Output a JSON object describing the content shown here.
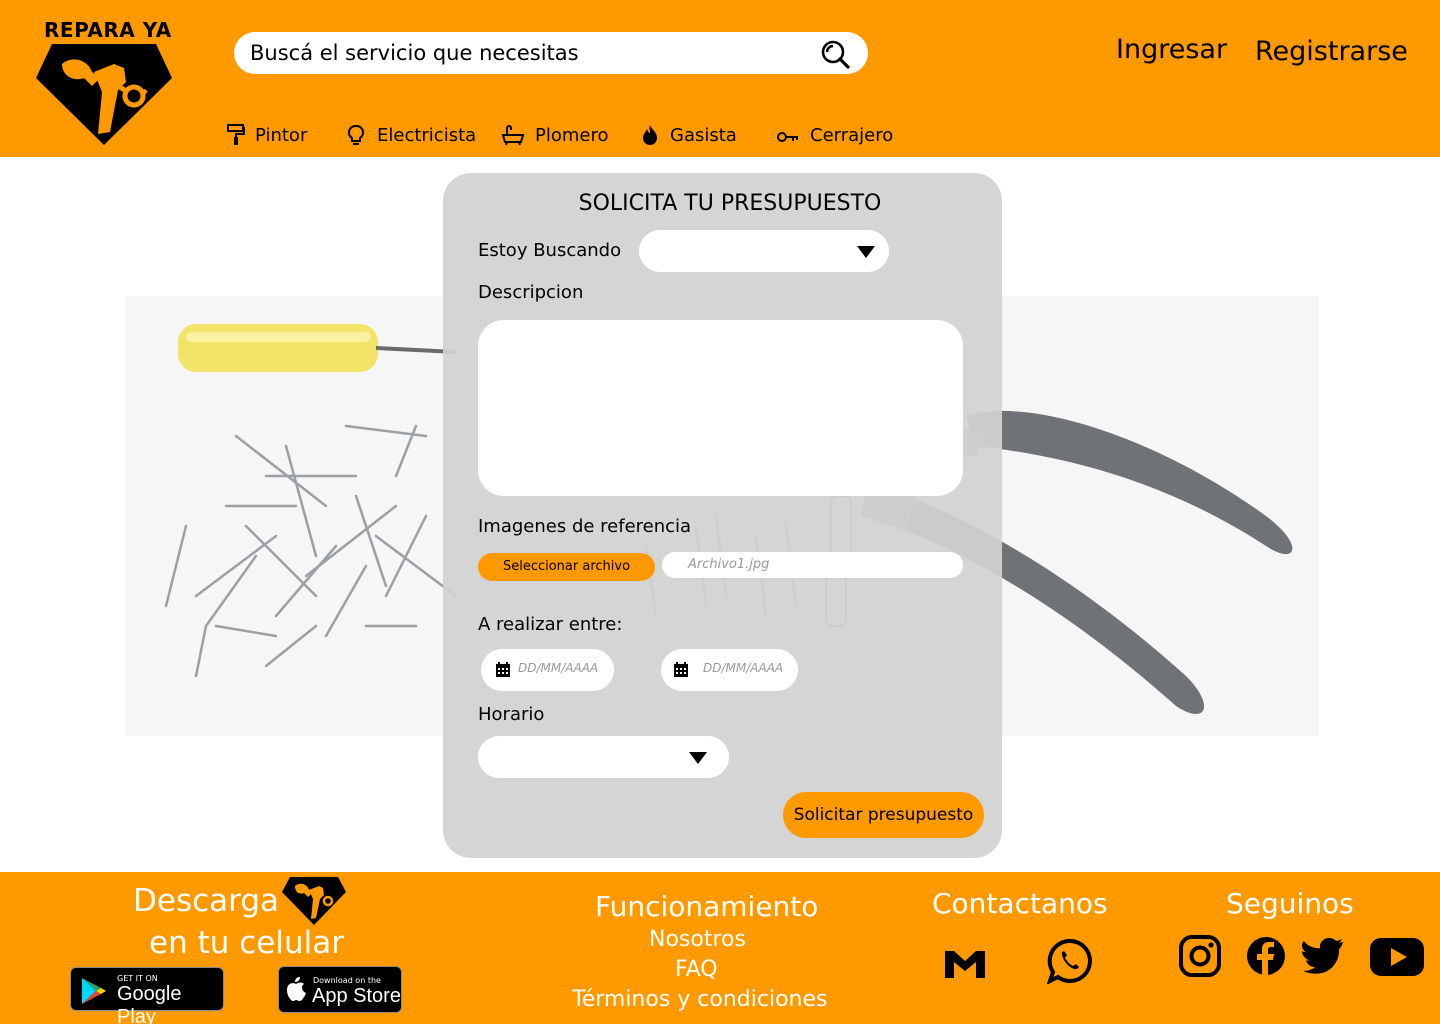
{
  "brand": {
    "name": "REPARA YA"
  },
  "search": {
    "placeholder": "Buscá el servicio que necesitas"
  },
  "auth": {
    "login": "Ingresar",
    "register": "Registrarse"
  },
  "nav": [
    {
      "label": "Pintor",
      "icon": "paint-roller-icon"
    },
    {
      "label": "Electricista",
      "icon": "lightbulb-icon"
    },
    {
      "label": "Plomero",
      "icon": "bathtub-icon"
    },
    {
      "label": "Gasista",
      "icon": "flame-icon"
    },
    {
      "label": "Cerrajero",
      "icon": "key-icon"
    }
  ],
  "form": {
    "title": "SOLICITA TU PRESUPUESTO",
    "looking_label": "Estoy Buscando",
    "looking_value": "",
    "description_label": "Descripcion",
    "description_value": "",
    "images_label": "Imagenes de referencia",
    "file_button": "Seleccionar archivo",
    "file_name": "Archivo1.jpg",
    "date_label": "A realizar entre:",
    "date_from_placeholder": "DD/MM/AAAA",
    "date_to_placeholder": "DD/MM/AAAA",
    "schedule_label": "Horario",
    "schedule_value": "",
    "submit": "Solicitar presupuesto"
  },
  "footer": {
    "download_line1": "Descarga",
    "download_line2": "en tu celular",
    "google_play_small": "GET IT ON",
    "google_play_big": "Google Play",
    "app_store_small": "Download on the",
    "app_store_big": "App Store",
    "how_title": "Funcionamiento",
    "links": [
      "Nosotros",
      "FAQ",
      "Términos y condiciones"
    ],
    "contact_title": "Contactanos",
    "follow_title": "Seguinos"
  },
  "colors": {
    "accent": "#FF9900",
    "card": "#D2D2D2",
    "text": "#000000",
    "footer_text": "#FFFFFF"
  }
}
